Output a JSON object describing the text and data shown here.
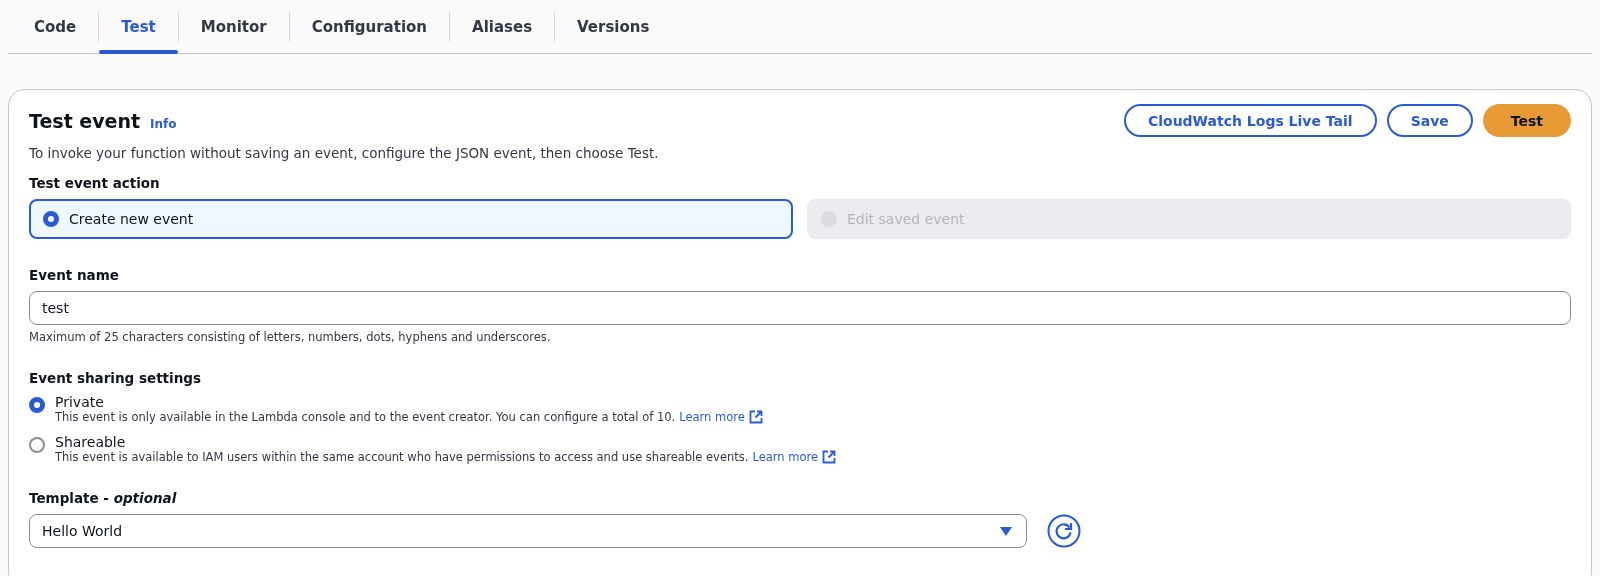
{
  "tabs": [
    {
      "label": "Code",
      "selected": false
    },
    {
      "label": "Test",
      "selected": true
    },
    {
      "label": "Monitor",
      "selected": false
    },
    {
      "label": "Configuration",
      "selected": false
    },
    {
      "label": "Aliases",
      "selected": false
    },
    {
      "label": "Versions",
      "selected": false
    }
  ],
  "panel": {
    "title": "Test event",
    "info_link": "Info",
    "description": "To invoke your function without saving an event, configure the JSON event, then choose Test.",
    "buttons": [
      {
        "label": "CloudWatch Logs Live Tail",
        "kind": "normal"
      },
      {
        "label": "Save",
        "kind": "normal"
      },
      {
        "label": "Test",
        "kind": "primary"
      }
    ]
  },
  "action": {
    "label": "Test event action",
    "options": [
      {
        "label": "Create new event",
        "selected": true,
        "disabled": false
      },
      {
        "label": "Edit saved event",
        "selected": false,
        "disabled": true
      }
    ]
  },
  "event_name": {
    "label": "Event name",
    "value": "test",
    "hint": "Maximum of 25 characters consisting of letters, numbers, dots, hyphens and underscores."
  },
  "sharing": {
    "label": "Event sharing settings",
    "options": [
      {
        "label": "Private",
        "selected": true,
        "description": "This event is only available in the Lambda console and to the event creator. You can configure a total of 10.",
        "link": "Learn more"
      },
      {
        "label": "Shareable",
        "selected": false,
        "description": "This event is available to IAM users within the same account who have permissions to access and use shareable events.",
        "link": "Learn more"
      }
    ]
  },
  "template": {
    "label": "Template - *optional*",
    "value": "Hello World"
  }
}
